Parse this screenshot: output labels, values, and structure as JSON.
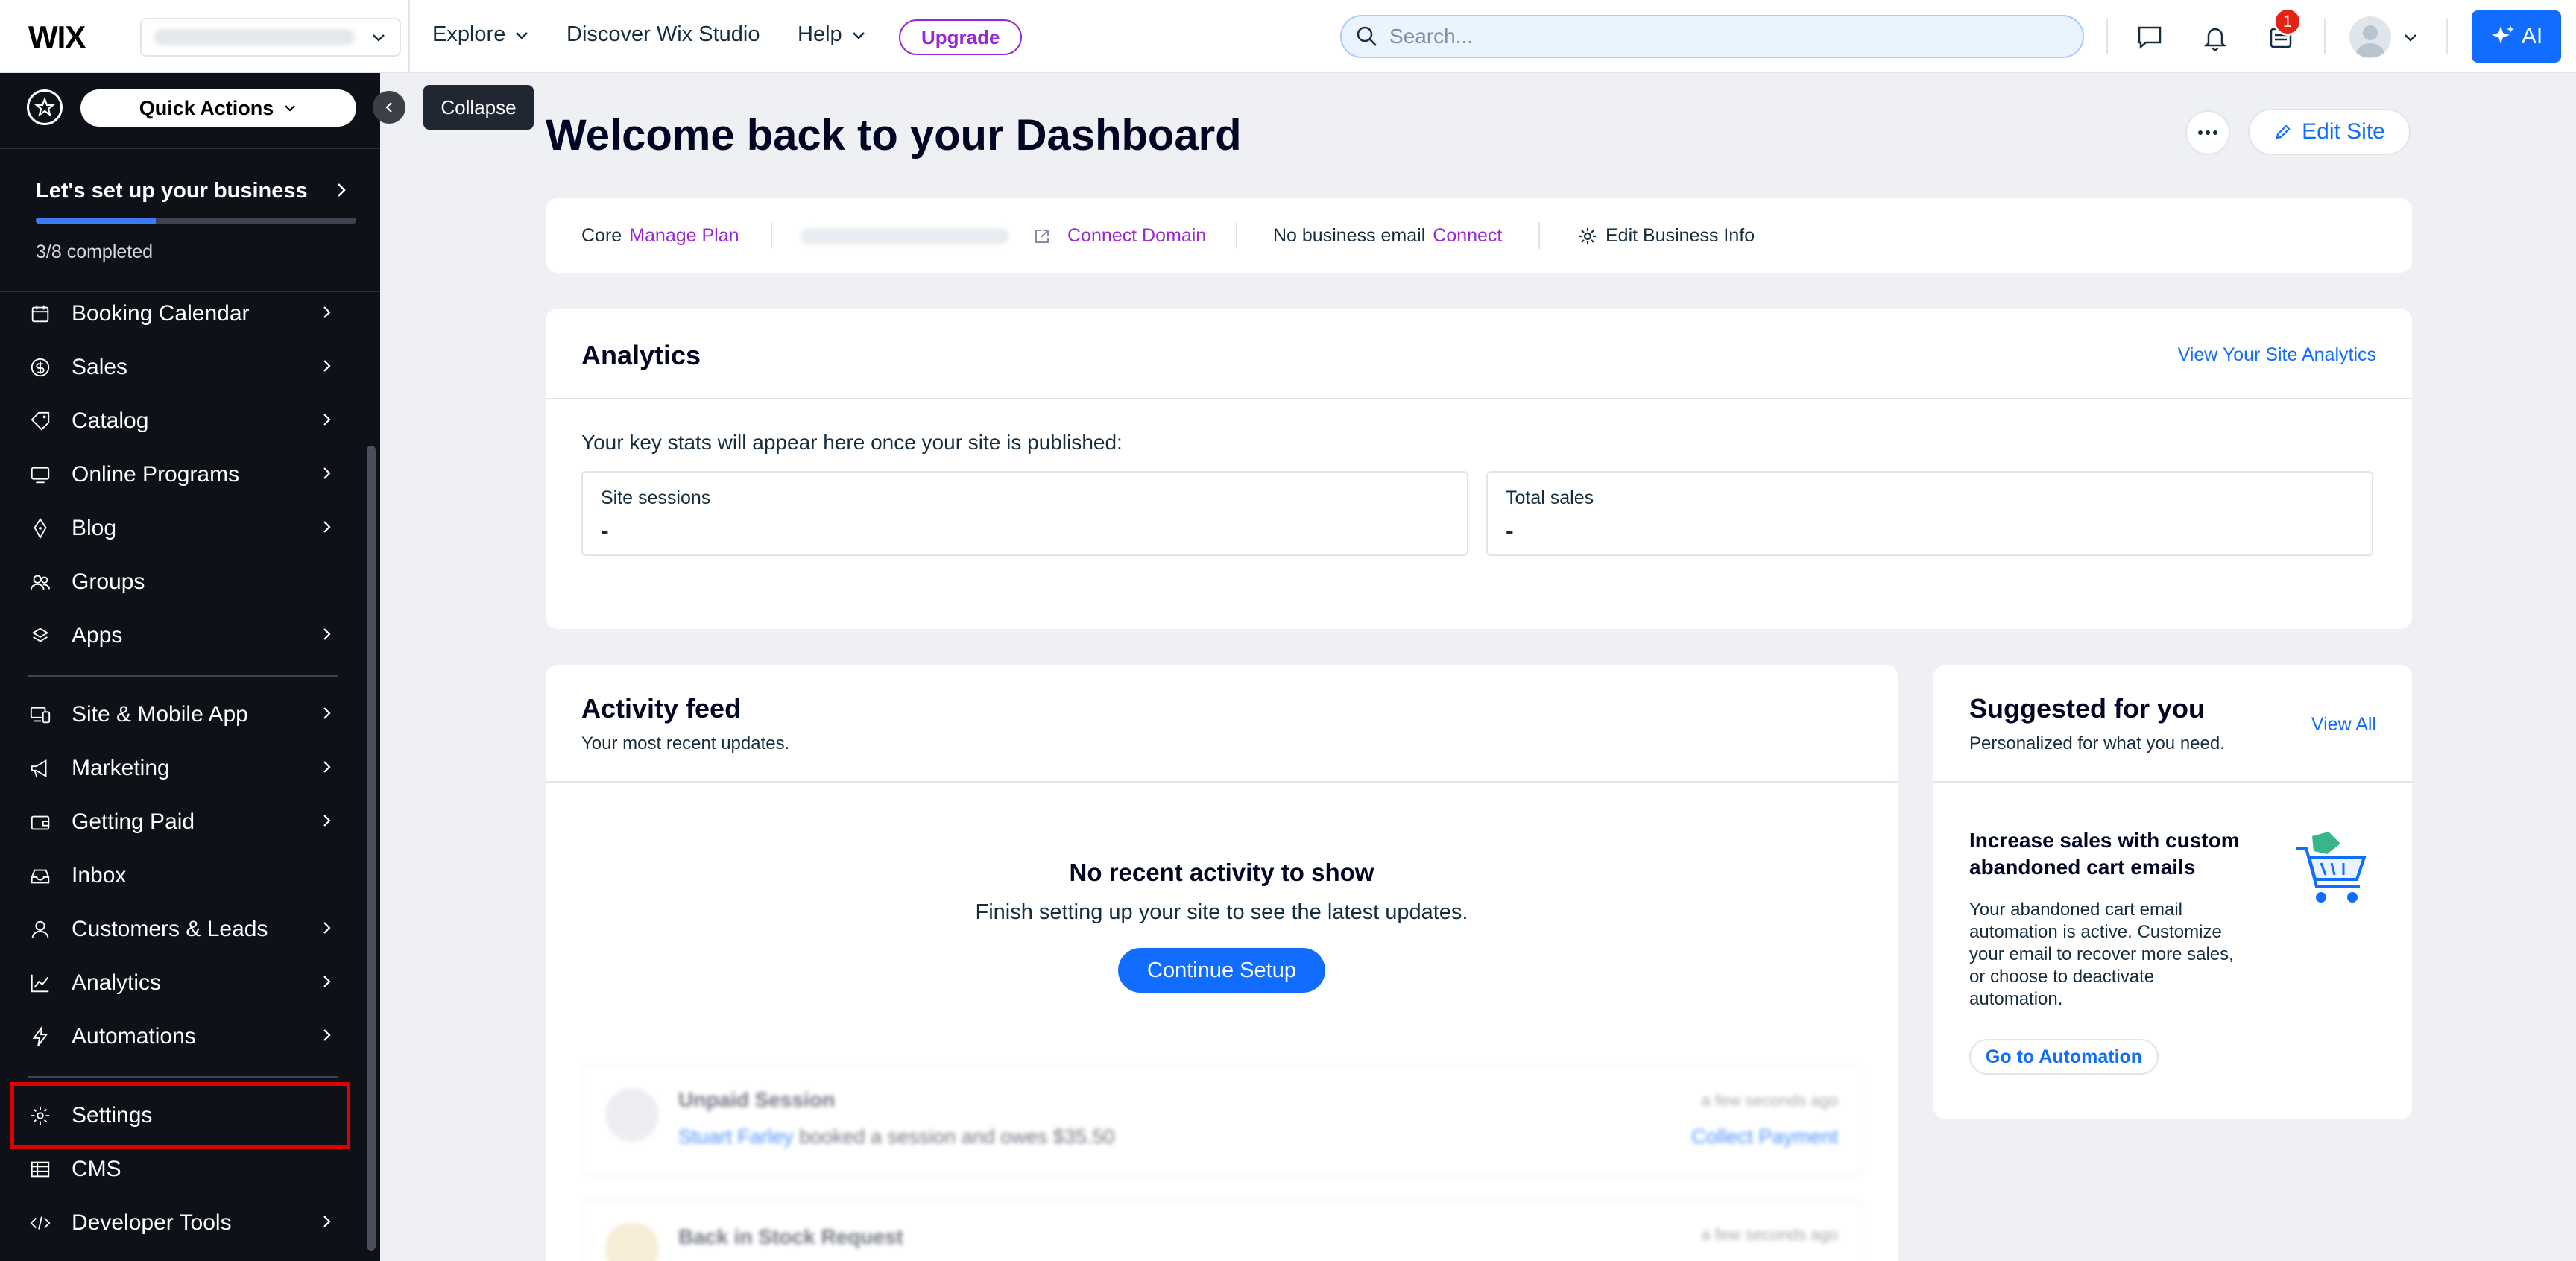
{
  "topbar": {
    "logo": "WIX",
    "nav": [
      "Explore",
      "Discover Wix Studio",
      "Help"
    ],
    "upgrade": "Upgrade",
    "search_placeholder": "Search...",
    "notification_count": "1",
    "ai_label": "AI"
  },
  "sidebar": {
    "quick_actions": "Quick Actions",
    "setup_title": "Let's set up your business",
    "setup_progress": "3/8 completed",
    "setup_fraction": 0.375,
    "items": [
      {
        "label": "Booking Calendar",
        "icon": "calendar-icon",
        "chevron": true
      },
      {
        "label": "Sales",
        "icon": "dollar-icon",
        "chevron": true
      },
      {
        "label": "Catalog",
        "icon": "tag-icon",
        "chevron": true
      },
      {
        "label": "Online Programs",
        "icon": "monitor-icon",
        "chevron": true
      },
      {
        "label": "Blog",
        "icon": "pen-icon",
        "chevron": true
      },
      {
        "label": "Groups",
        "icon": "groups-icon",
        "chevron": false
      },
      {
        "label": "Apps",
        "icon": "apps-icon",
        "chevron": true
      }
    ],
    "items2": [
      {
        "label": "Site & Mobile App",
        "icon": "devices-icon",
        "chevron": true
      },
      {
        "label": "Marketing",
        "icon": "megaphone-icon",
        "chevron": true
      },
      {
        "label": "Getting Paid",
        "icon": "wallet-icon",
        "chevron": true
      },
      {
        "label": "Inbox",
        "icon": "inbox-icon",
        "chevron": false
      },
      {
        "label": "Customers & Leads",
        "icon": "users-icon",
        "chevron": true
      },
      {
        "label": "Analytics",
        "icon": "chart-icon",
        "chevron": true
      },
      {
        "label": "Automations",
        "icon": "lightning-icon",
        "chevron": true
      }
    ],
    "items3": [
      {
        "label": "Settings",
        "icon": "gear-icon",
        "chevron": false
      },
      {
        "label": "CMS",
        "icon": "table-icon",
        "chevron": false
      },
      {
        "label": "Developer Tools",
        "icon": "code-icon",
        "chevron": true
      }
    ],
    "collapse_tooltip": "Collapse"
  },
  "main": {
    "title": "Welcome back to your Dashboard",
    "edit_site": "Edit Site",
    "info": {
      "plan": "Core",
      "manage_plan": "Manage Plan",
      "connect_domain": "Connect Domain",
      "no_email": "No business email",
      "connect": "Connect",
      "edit_business": "Edit Business Info"
    },
    "analytics": {
      "title": "Analytics",
      "link": "View Your Site Analytics",
      "note": "Your key stats will appear here once your site is published:",
      "stats": [
        {
          "label": "Site sessions",
          "value": "-"
        },
        {
          "label": "Total sales",
          "value": "-"
        }
      ]
    },
    "feed": {
      "title": "Activity feed",
      "subtitle": "Your most recent updates.",
      "empty_title": "No recent activity to show",
      "empty_sub": "Finish setting up your site to see the latest updates.",
      "continue": "Continue Setup",
      "ghost1_title": "Unpaid Session",
      "ghost1_time": "a few seconds ago",
      "ghost1_name": "Stuart Farley",
      "ghost1_text": " booked a session and owes $35.50",
      "ghost1_action": "Collect Payment",
      "ghost2_title": "Back in Stock Request",
      "ghost2_time": "a few seconds ago"
    },
    "suggested": {
      "title": "Suggested for you",
      "subtitle": "Personalized for what you need.",
      "view_all": "View All",
      "item_title": "Increase sales with custom abandoned cart emails",
      "item_body": "Your abandoned cart email automation is active. Customize your email to recover more sales, or choose to deactivate automation.",
      "item_button": "Go to Automation"
    }
  }
}
